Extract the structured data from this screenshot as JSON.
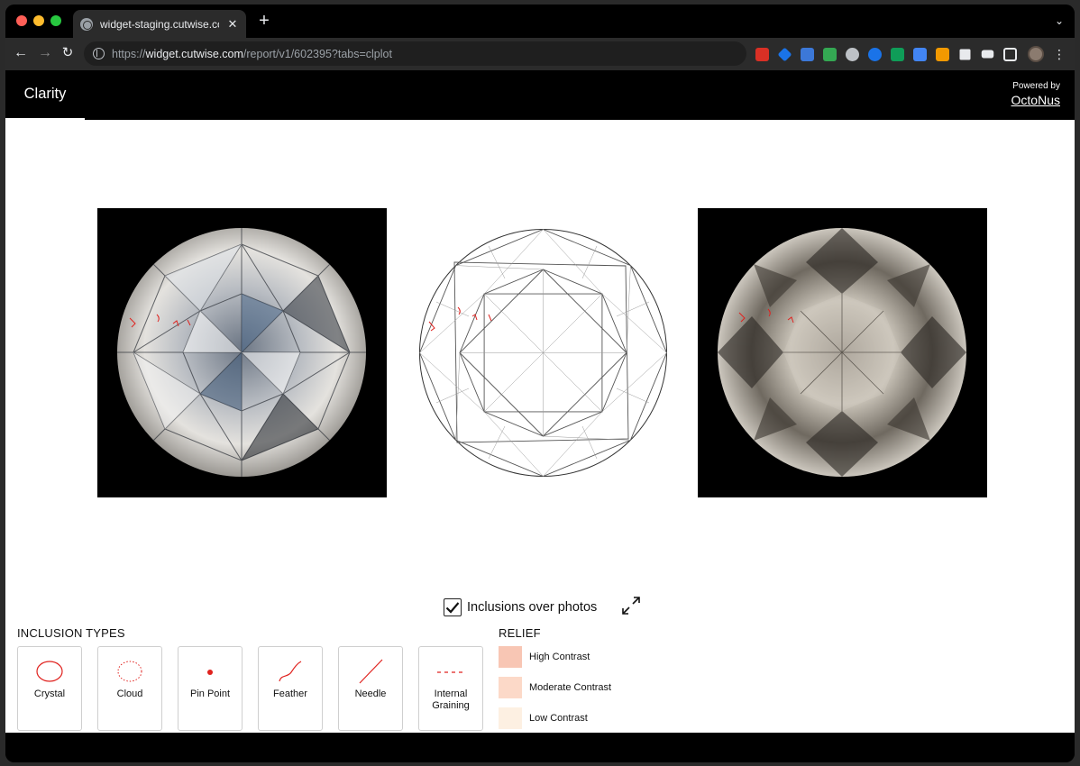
{
  "browser": {
    "tab_title": "widget-staging.cutwise.com/r",
    "url_scheme": "https://",
    "url_host": "widget.cutwise.com",
    "url_path": "/report/v1/602395?tabs=clplot"
  },
  "header": {
    "active_tab": "Clarity",
    "powered_by_label": "Powered by",
    "powered_by_link": "OctoNus"
  },
  "controls": {
    "inclusions_toggle_label": "Inclusions over photos",
    "inclusions_toggle_checked": true
  },
  "inclusion_types": {
    "title": "INCLUSION TYPES",
    "items": [
      {
        "label": "Crystal",
        "icon": "crystal-icon"
      },
      {
        "label": "Cloud",
        "icon": "cloud-icon"
      },
      {
        "label": "Pin Point",
        "icon": "pin-point-icon"
      },
      {
        "label": "Feather",
        "icon": "feather-icon"
      },
      {
        "label": "Needle",
        "icon": "needle-icon"
      },
      {
        "label": "Internal Graining",
        "icon": "internal-graining-icon"
      }
    ]
  },
  "relief": {
    "title": "RELIEF",
    "items": [
      {
        "label": "High Contrast",
        "color": "#f8c6b4"
      },
      {
        "label": "Moderate Contrast",
        "color": "#fcd9c8"
      },
      {
        "label": "Low Contrast",
        "color": "#fdf0e2"
      }
    ]
  },
  "colors": {
    "inclusion_red": "#e0221e",
    "header_bg": "#000000"
  }
}
